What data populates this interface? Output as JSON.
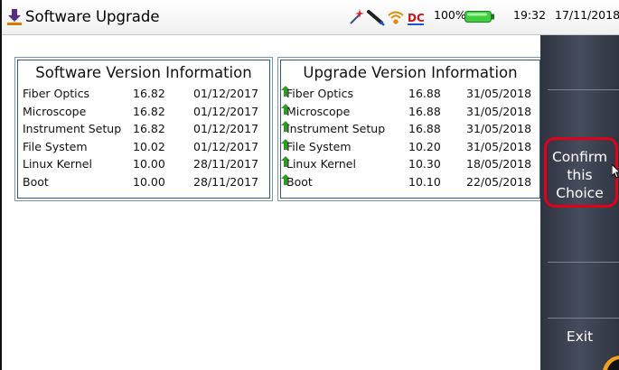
{
  "window": {
    "title": "Software Upgrade",
    "app_icon": "download-arrow-icon"
  },
  "statusbar": {
    "icons": [
      "magic-wand-icon",
      "probe-icon",
      "wifi-icon",
      "dc-power-icon"
    ],
    "battery_percent": "100%",
    "battery_icon": "battery-full-icon",
    "time": "19:32",
    "date": "17/11/2018"
  },
  "software_version": {
    "title": "Software Version Information",
    "rows": [
      {
        "name": "Fiber Optics",
        "version": "16.82",
        "date": "01/12/2017"
      },
      {
        "name": "Microscope",
        "version": "16.82",
        "date": "01/12/2017"
      },
      {
        "name": "Instrument Setup",
        "version": "16.82",
        "date": "01/12/2017"
      },
      {
        "name": "File System",
        "version": "10.02",
        "date": "01/12/2017"
      },
      {
        "name": "Linux Kernel",
        "version": "10.00",
        "date": "28/11/2017"
      },
      {
        "name": "Boot",
        "version": "10.00",
        "date": "28/11/2017"
      }
    ]
  },
  "upgrade_version": {
    "title": "Upgrade Version Information",
    "rows": [
      {
        "name": "Fiber Optics",
        "version": "16.88",
        "date": "31/05/2018",
        "icon": "green-up-arrow-icon"
      },
      {
        "name": "Microscope",
        "version": "16.88",
        "date": "31/05/2018",
        "icon": "green-up-arrow-icon"
      },
      {
        "name": "Instrument Setup",
        "version": "16.88",
        "date": "31/05/2018",
        "icon": "green-up-arrow-icon"
      },
      {
        "name": "File System",
        "version": "10.20",
        "date": "31/05/2018",
        "icon": "green-up-arrow-icon"
      },
      {
        "name": "Linux Kernel",
        "version": "10.30",
        "date": "18/05/2018",
        "icon": "green-up-arrow-icon"
      },
      {
        "name": "Boot",
        "version": "10.10",
        "date": "22/05/2018",
        "icon": "green-up-arrow-icon"
      }
    ]
  },
  "sidebar": {
    "confirm": {
      "line1": "Confirm",
      "line2": "this",
      "line3": "Choice"
    },
    "exit": "Exit"
  },
  "colors": {
    "panel_border": "#2e5a82",
    "highlight_box": "#e3001b",
    "arrow_green": "#2f9a22",
    "sidebar": "#3b4150"
  }
}
